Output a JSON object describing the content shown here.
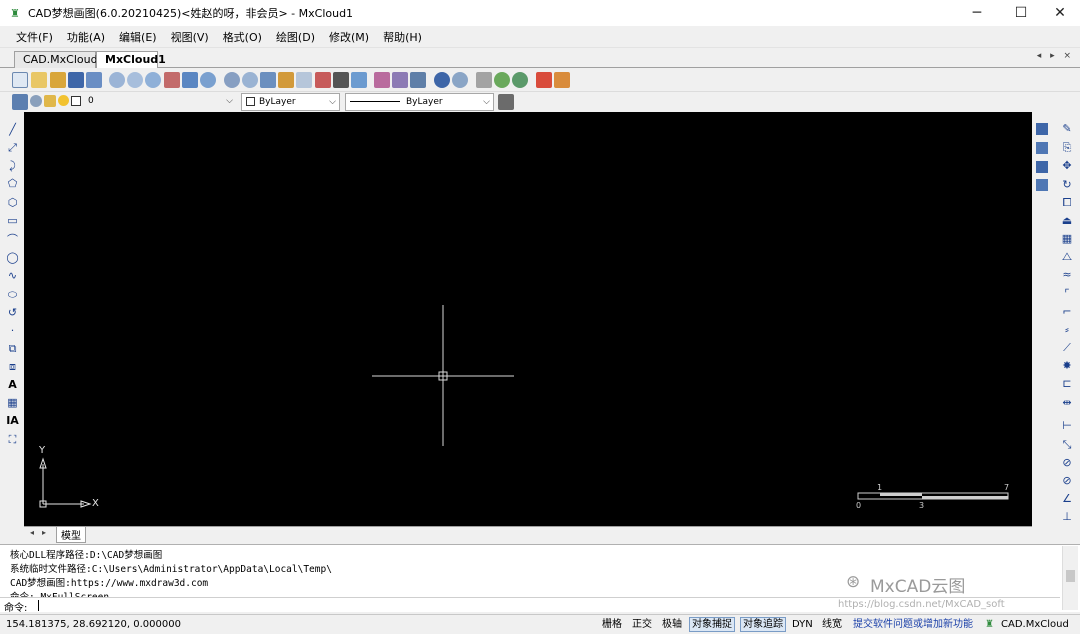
{
  "window": {
    "title": "CAD梦想画图(6.0.20210425)<姓赵的呀，非会员> - MxCloud1",
    "minimize": "─",
    "maximize": "☐",
    "close": "✕"
  },
  "menu": [
    "文件(F)",
    "功能(A)",
    "编辑(E)",
    "视图(V)",
    "格式(O)",
    "绘图(D)",
    "修改(M)",
    "帮助(H)"
  ],
  "tabs": [
    "CAD.MxCloud",
    "MxCloud1"
  ],
  "tab_scroll": "◂ ▸ ×",
  "properties": {
    "layer_value": "0",
    "color_value": "ByLayer",
    "linetype_value": "ByLayer"
  },
  "ucs": {
    "y_label": "Y",
    "x_label": "X"
  },
  "scale_bar": {
    "top_left": "1",
    "top_right": "7",
    "bottom_left": "0",
    "bottom_mid": "3"
  },
  "model_tab": "模型",
  "command_history": [
    "核心DLL程序路径:D:\\CAD梦想画图",
    "系统临时文件路径:C:\\Users\\Administrator\\AppData\\Local\\Temp\\",
    "CAD梦想画图:https://www.mxdraw3d.com",
    "命令: MxFullScreen"
  ],
  "command_prompt": "命令:",
  "status": {
    "coords": "154.181375,  28.692120,  0.000000",
    "toggles": [
      {
        "label": "栅格",
        "on": false
      },
      {
        "label": "正交",
        "on": false
      },
      {
        "label": "极轴",
        "on": false
      },
      {
        "label": "对象捕捉",
        "on": true
      },
      {
        "label": "对象追踪",
        "on": true
      },
      {
        "label": "DYN",
        "on": false
      },
      {
        "label": "线宽",
        "on": false
      }
    ],
    "link": "提交软件问题或增加新功能",
    "app_name": "CAD.MxCloud"
  },
  "watermark": {
    "main": "MxCAD云图",
    "url": "https://blog.csdn.net/MxCAD_soft"
  }
}
